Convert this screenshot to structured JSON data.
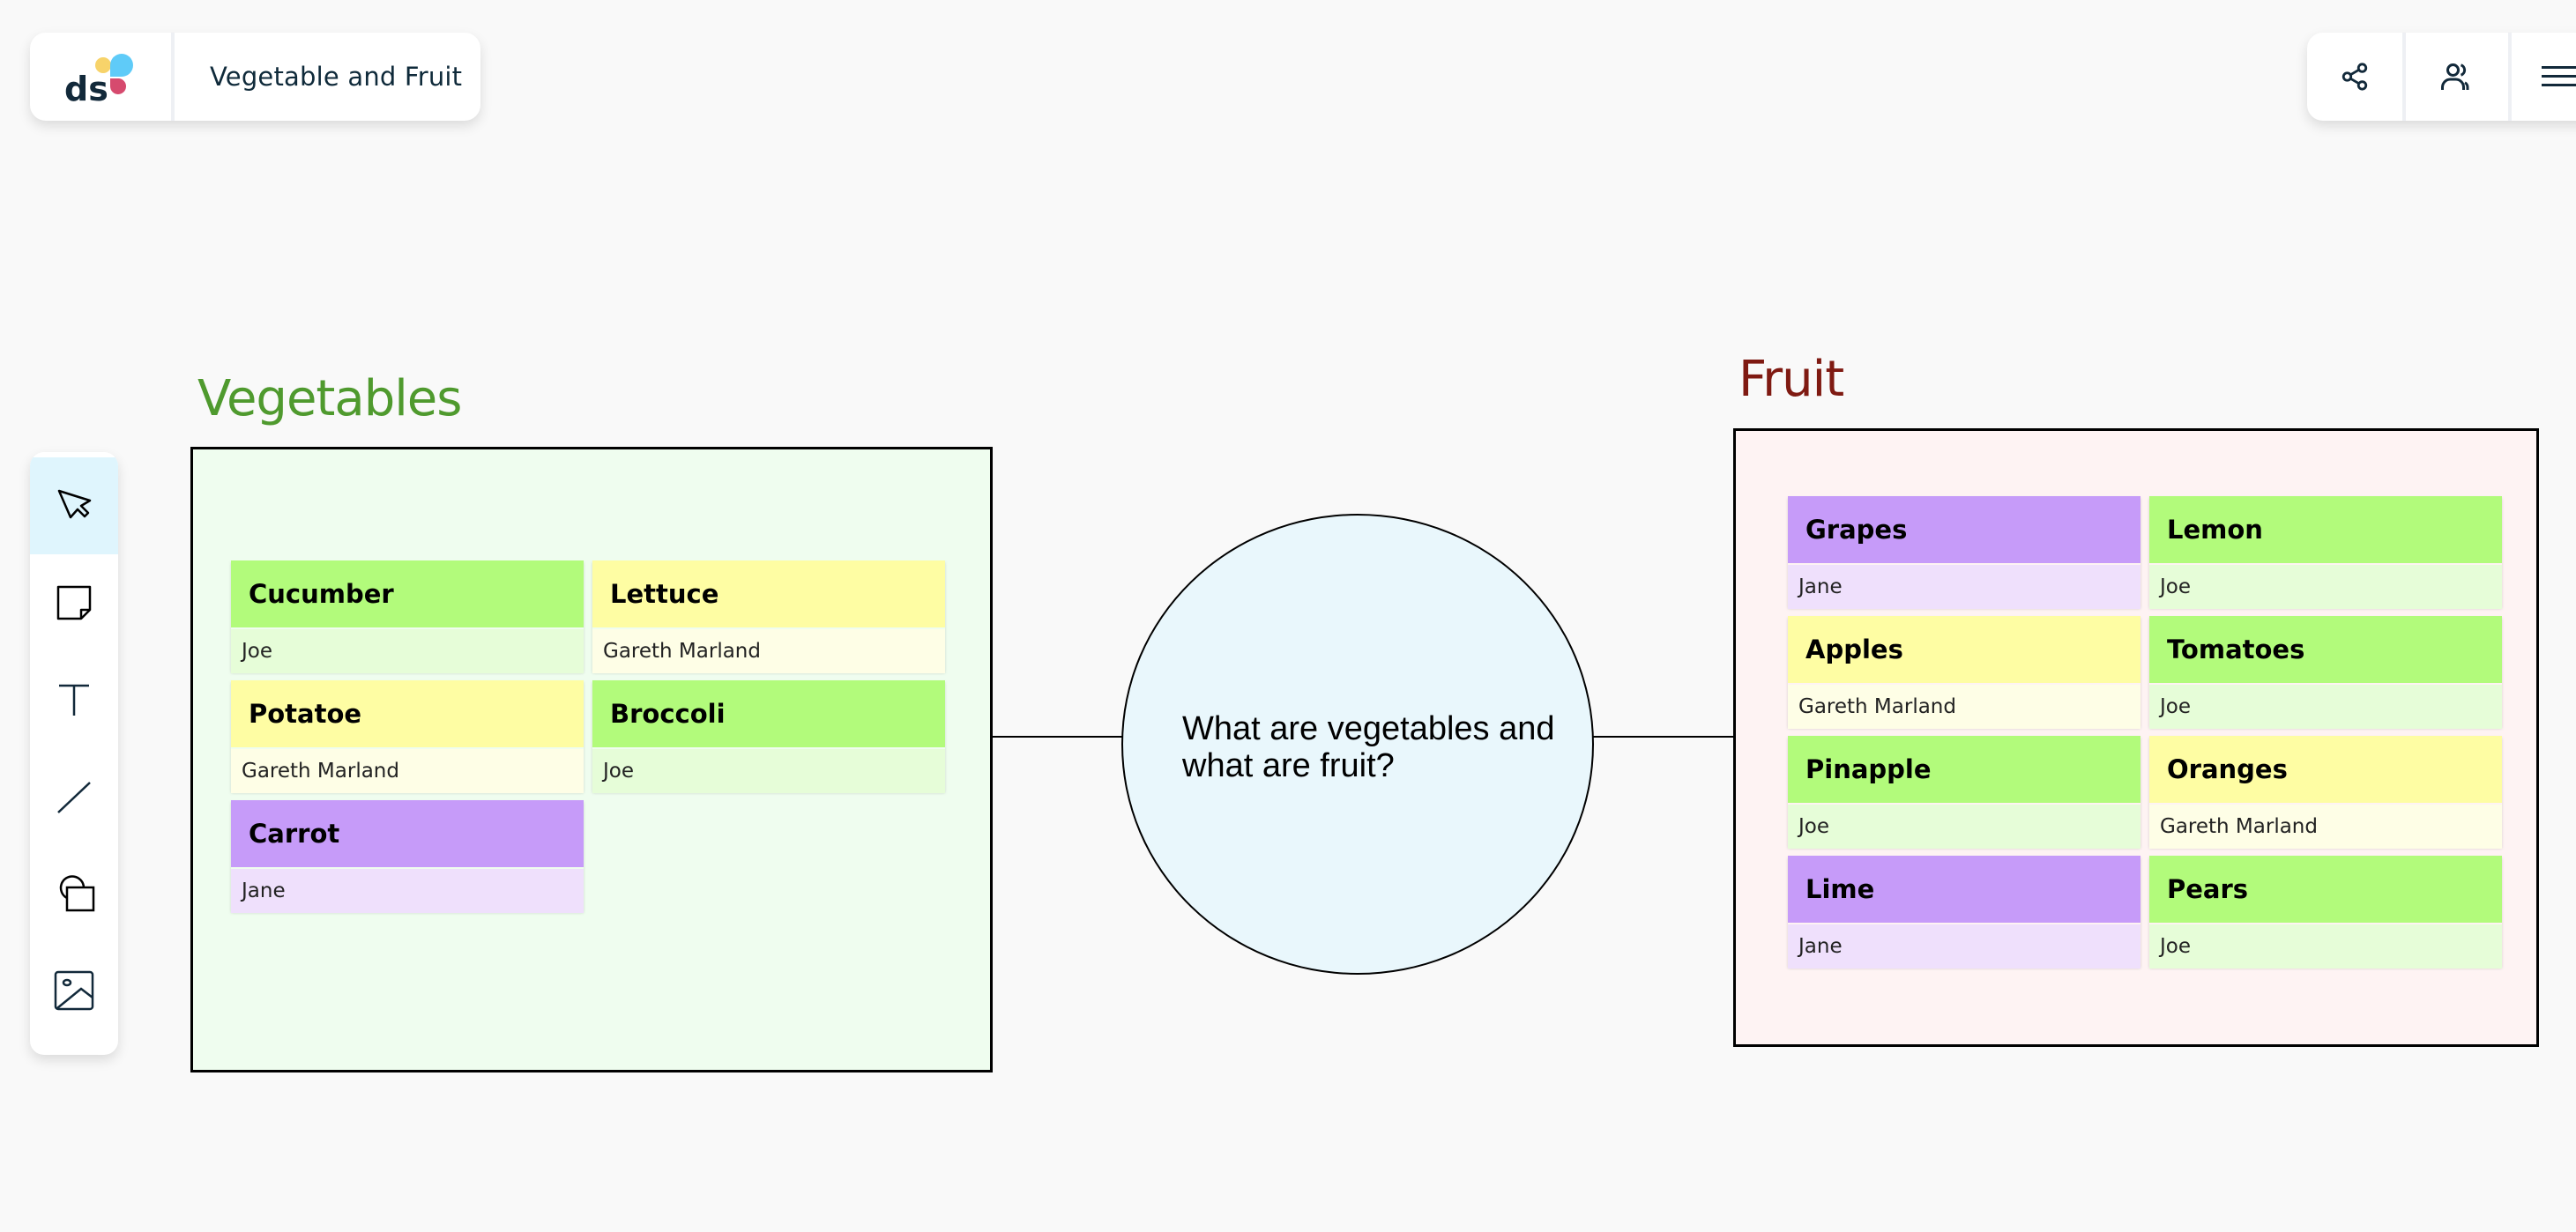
{
  "header": {
    "logo_alt": "ds",
    "board_title": "Vegetable and Fruit"
  },
  "top_right_toolbar": [
    {
      "name": "share",
      "icon": "share-icon"
    },
    {
      "name": "collaborators",
      "icon": "users-icon"
    },
    {
      "name": "menu",
      "icon": "menu-icon"
    }
  ],
  "left_toolbar": [
    {
      "name": "select",
      "icon": "cursor-icon",
      "active": true
    },
    {
      "name": "sticky-note",
      "icon": "sticky-note-icon",
      "active": false
    },
    {
      "name": "text",
      "icon": "text-icon",
      "active": false
    },
    {
      "name": "line",
      "icon": "line-icon",
      "active": false
    },
    {
      "name": "shapes",
      "icon": "shapes-icon",
      "active": false
    },
    {
      "name": "image",
      "icon": "image-icon",
      "active": false
    }
  ],
  "colors": {
    "green_head": "#b2fb7b",
    "green_foot": "#e6fdd8",
    "yellow_head": "#fefda3",
    "yellow_foot": "#fefee6",
    "purple_head": "#c69bf9",
    "purple_foot": "#efe0fc"
  },
  "vegetables": {
    "title": "Vegetables",
    "notes": [
      {
        "title": "Cucumber",
        "author": "Joe",
        "color": "green"
      },
      {
        "title": "Lettuce",
        "author": "Gareth Marland",
        "color": "yellow"
      },
      {
        "title": "Potatoe",
        "author": "Gareth Marland",
        "color": "yellow"
      },
      {
        "title": "Broccoli",
        "author": "Joe",
        "color": "green"
      },
      {
        "title": "Carrot",
        "author": "Jane",
        "color": "purple"
      }
    ]
  },
  "center": {
    "question": "What are vegetables and what are fruit?"
  },
  "fruit": {
    "title": "Fruit",
    "notes": [
      {
        "title": "Grapes",
        "author": "Jane",
        "color": "purple"
      },
      {
        "title": "Lemon",
        "author": "Joe",
        "color": "green"
      },
      {
        "title": "Apples",
        "author": "Gareth Marland",
        "color": "yellow"
      },
      {
        "title": "Tomatoes",
        "author": "Joe",
        "color": "green"
      },
      {
        "title": "Pinapple",
        "author": "Joe",
        "color": "green"
      },
      {
        "title": "Oranges",
        "author": "Gareth Marland",
        "color": "yellow"
      },
      {
        "title": "Lime",
        "author": "Jane",
        "color": "purple"
      },
      {
        "title": "Pears",
        "author": "Joe",
        "color": "green"
      }
    ]
  }
}
